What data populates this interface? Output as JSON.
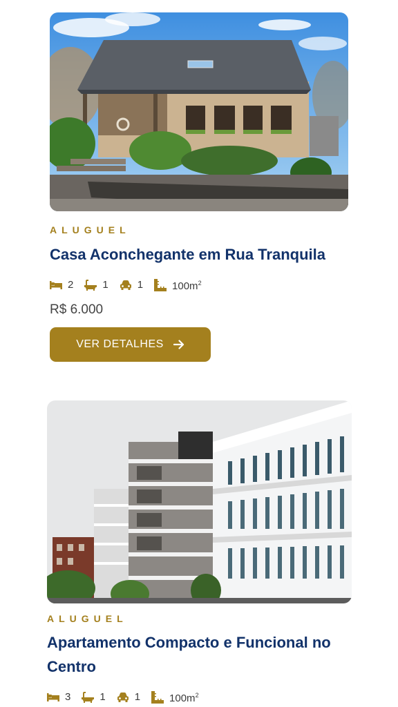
{
  "listings": [
    {
      "category": "ALUGUEL",
      "title": "Casa Aconchegante em Rua Tranquila",
      "bedrooms": "2",
      "bathrooms": "1",
      "parking": "1",
      "area": "100m",
      "area_unit_sup": "2",
      "price": "R$ 6.000",
      "button_label": "VER DETALHES"
    },
    {
      "category": "ALUGUEL",
      "title": "Apartamento Compacto e Funcional no Centro",
      "bedrooms": "3",
      "bathrooms": "1",
      "parking": "1",
      "area": "100m",
      "area_unit_sup": "2"
    }
  ],
  "colors": {
    "accent": "#a4801e",
    "title": "#12326a",
    "text": "#444444",
    "background": "#ffffff"
  },
  "icons": [
    "bed-icon",
    "bathtub-icon",
    "car-icon",
    "ruler-icon",
    "arrow-right-icon"
  ]
}
